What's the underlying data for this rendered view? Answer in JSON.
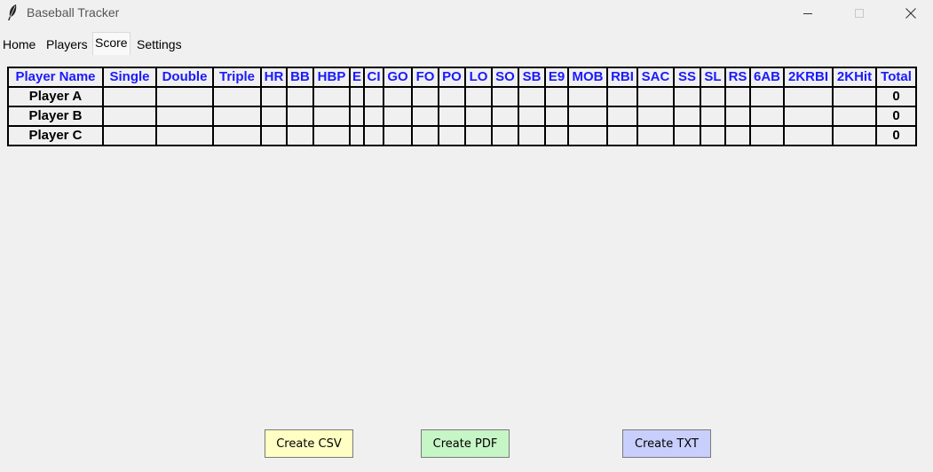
{
  "window": {
    "title": "Baseball Tracker"
  },
  "tabs": [
    {
      "label": "Home",
      "active": false
    },
    {
      "label": "Players",
      "active": false
    },
    {
      "label": "Score",
      "active": true
    },
    {
      "label": "Settings",
      "active": false
    }
  ],
  "table": {
    "columns": [
      "Player Name",
      "Single",
      "Double",
      "Triple",
      "HR",
      "BB",
      "HBP",
      "E",
      "CI",
      "GO",
      "FO",
      "PO",
      "LO",
      "SO",
      "SB",
      "E9",
      "MOB",
      "RBI",
      "SAC",
      "SS",
      "SL",
      "RS",
      "6AB",
      "2KRBI",
      "2KHit",
      "Total"
    ],
    "rows": [
      {
        "name": "Player A",
        "total": "0"
      },
      {
        "name": "Player B",
        "total": "0"
      },
      {
        "name": "Player C",
        "total": "0"
      }
    ]
  },
  "buttons": {
    "csv": {
      "label": "Create CSV",
      "color": "#ffffc4"
    },
    "pdf": {
      "label": "Create PDF",
      "color": "#c6f5c6"
    },
    "txt": {
      "label": "Create TXT",
      "color": "#c8cffd"
    }
  },
  "colors": {
    "header_text": "#1a1aff",
    "background": "#f0f0f0"
  }
}
